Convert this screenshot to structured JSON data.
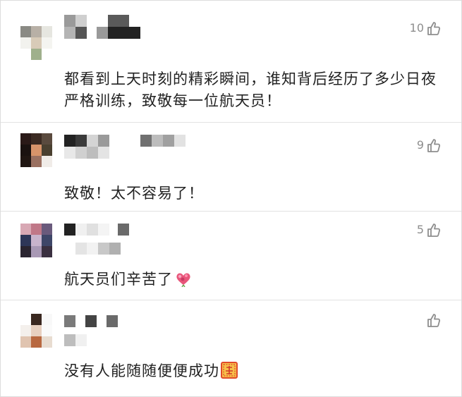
{
  "colors": {
    "text": "#222222",
    "meta": "#8e8e8e",
    "divider": "#e2e2e2",
    "background": "#ffffff"
  },
  "comments": [
    {
      "likes": "10",
      "text": "都看到上天时刻的精彩瞬间，谁知背后经历了多少日夜严格训练，致敬每一位航天员！",
      "emoji": ""
    },
    {
      "likes": "9",
      "text": "致敬！太不容易了！",
      "emoji": ""
    },
    {
      "likes": "5",
      "text": "航天员们辛苦了",
      "emoji": "heart-bouquet-emoji"
    },
    {
      "likes": "",
      "text": "没有人能随随便便成功",
      "emoji": "zan-stamp-emoji"
    }
  ],
  "icons": {
    "like": "thumbs-up-outline-icon"
  }
}
